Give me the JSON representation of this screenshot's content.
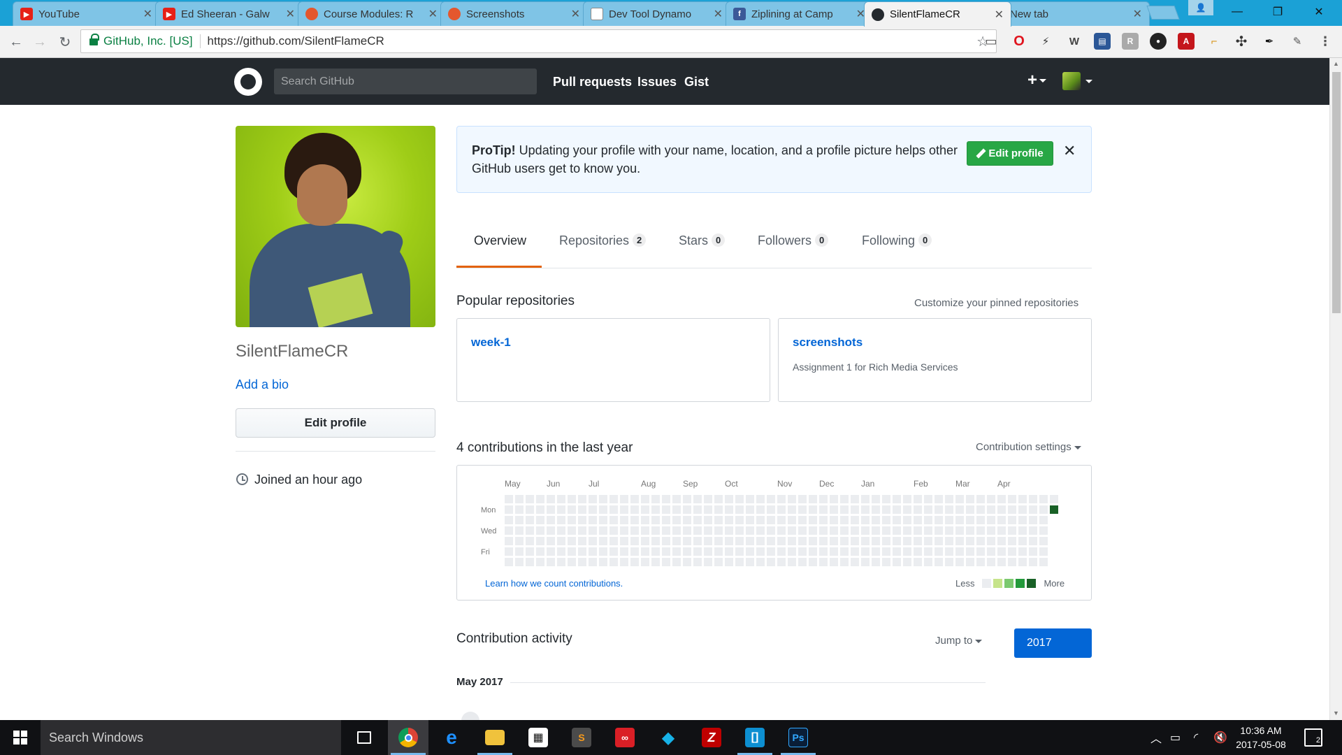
{
  "browser": {
    "tabs": [
      {
        "title": "YouTube",
        "icon": "youtube-icon",
        "color": "#e62117"
      },
      {
        "title": "Ed Sheeran - Galw",
        "icon": "youtube-icon",
        "color": "#e62117"
      },
      {
        "title": "Course Modules: R",
        "icon": "canvas-icon",
        "color": "#e4572e"
      },
      {
        "title": "Screenshots",
        "icon": "canvas-icon",
        "color": "#e4572e"
      },
      {
        "title": "Dev Tool Dynamo",
        "icon": "document-icon",
        "color": "#777777"
      },
      {
        "title": "Ziplining at Camp",
        "icon": "facebook-icon",
        "color": "#3b5998"
      },
      {
        "title": "SilentFlameCR",
        "icon": "github-icon",
        "color": "#24292e",
        "active": true
      },
      {
        "title": "New tab",
        "icon": "",
        "color": ""
      }
    ],
    "security_label": "GitHub, Inc. [US]",
    "url": "https://github.com/SilentFlameCR"
  },
  "github_header": {
    "search_placeholder": "Search GitHub",
    "nav": [
      "Pull requests",
      "Issues",
      "Gist"
    ],
    "plus": "+"
  },
  "profile": {
    "username": "SilentFlameCR",
    "add_bio": "Add a bio",
    "edit_profile": "Edit profile",
    "joined": "Joined an hour ago"
  },
  "protip": {
    "lead": "ProTip!",
    "text": " Updating your profile with your name, location, and a profile picture helps other GitHub users get to know you.",
    "button": "Edit profile",
    "close": "✕"
  },
  "tabs": [
    {
      "label": "Overview",
      "count": null
    },
    {
      "label": "Repositories",
      "count": "2"
    },
    {
      "label": "Stars",
      "count": "0"
    },
    {
      "label": "Followers",
      "count": "0"
    },
    {
      "label": "Following",
      "count": "0"
    }
  ],
  "popular": {
    "title": "Popular repositories",
    "customize": "Customize your pinned repositories",
    "repos": [
      {
        "name": "week-1",
        "description": ""
      },
      {
        "name": "screenshots",
        "description": "Assignment 1 for Rich Media Services"
      }
    ]
  },
  "contributions": {
    "title": "4 contributions in the last year",
    "settings": "Contribution settings",
    "months": [
      "May",
      "Jun",
      "Jul",
      "Aug",
      "Sep",
      "Oct",
      "Nov",
      "Dec",
      "Jan",
      "Feb",
      "Mar",
      "Apr"
    ],
    "days": [
      "Mon",
      "Wed",
      "Fri"
    ],
    "learn": "Learn how we count contributions.",
    "legend_less": "Less",
    "legend_more": "More",
    "colors": [
      "#ebedf0",
      "#c6e48b",
      "#7bc96f",
      "#239a3b",
      "#196127"
    ],
    "highlight": {
      "week": 53,
      "day": "Mon",
      "level": 4
    }
  },
  "activity": {
    "title": "Contribution activity",
    "jump_to": "Jump to",
    "year": "2017",
    "month": "May 2017"
  },
  "taskbar": {
    "search": "Search Windows",
    "time": "10:36 AM",
    "date": "2017-05-08",
    "notifications": "2"
  }
}
